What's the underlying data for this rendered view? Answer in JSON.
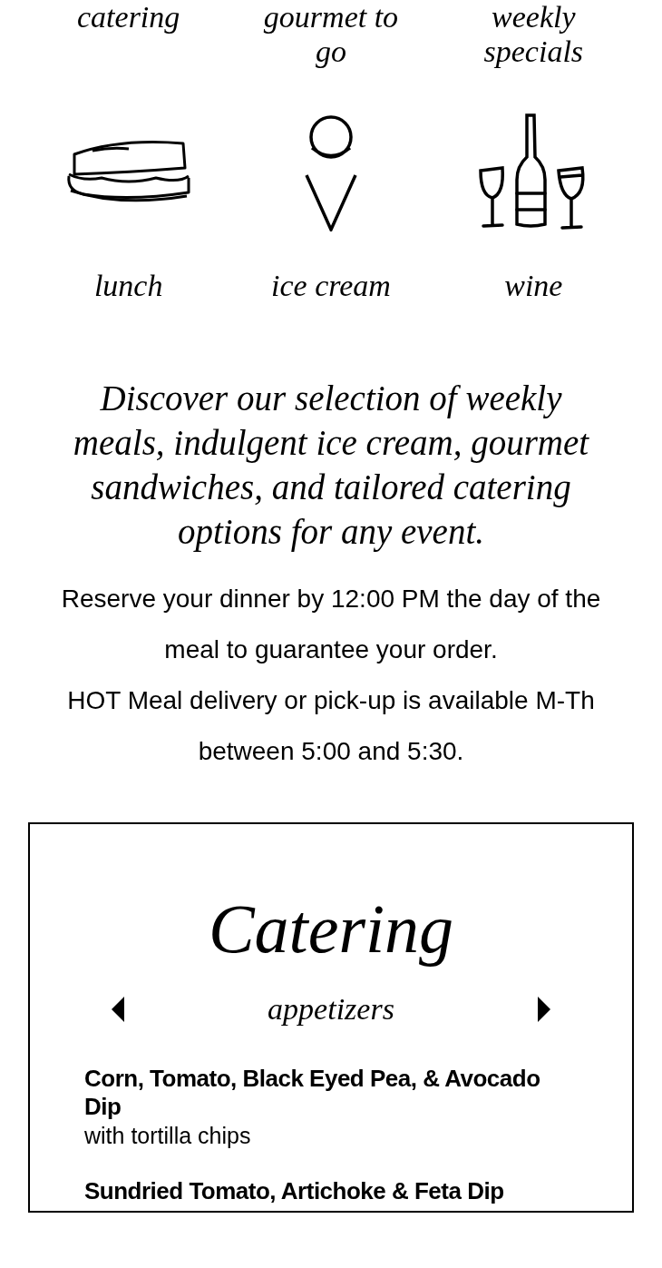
{
  "top_row": [
    {
      "label": "catering"
    },
    {
      "label": "gourmet to go"
    },
    {
      "label": "weekly specials"
    }
  ],
  "icon_row": [
    {
      "kind": "sandwich",
      "label": "lunch"
    },
    {
      "kind": "cone",
      "label": "ice cream"
    },
    {
      "kind": "wine",
      "label": "wine"
    }
  ],
  "headline": "Discover our selection of weekly meals, indulgent ice cream, gourmet sandwiches, and tailored catering options for any event.",
  "notice": [
    "Reserve your dinner by 12:00 PM the day of the meal to guarantee your order.",
    "HOT Meal delivery or pick-up is available M-Th between 5:00 and 5:30."
  ],
  "menu": {
    "title": "Catering",
    "category": "appetizers",
    "items": [
      {
        "name": "Corn, Tomato, Black Eyed Pea, & Avocado Dip",
        "description": "with tortilla chips"
      },
      {
        "name": "Sundried Tomato, Artichoke & Feta Dip"
      }
    ]
  }
}
